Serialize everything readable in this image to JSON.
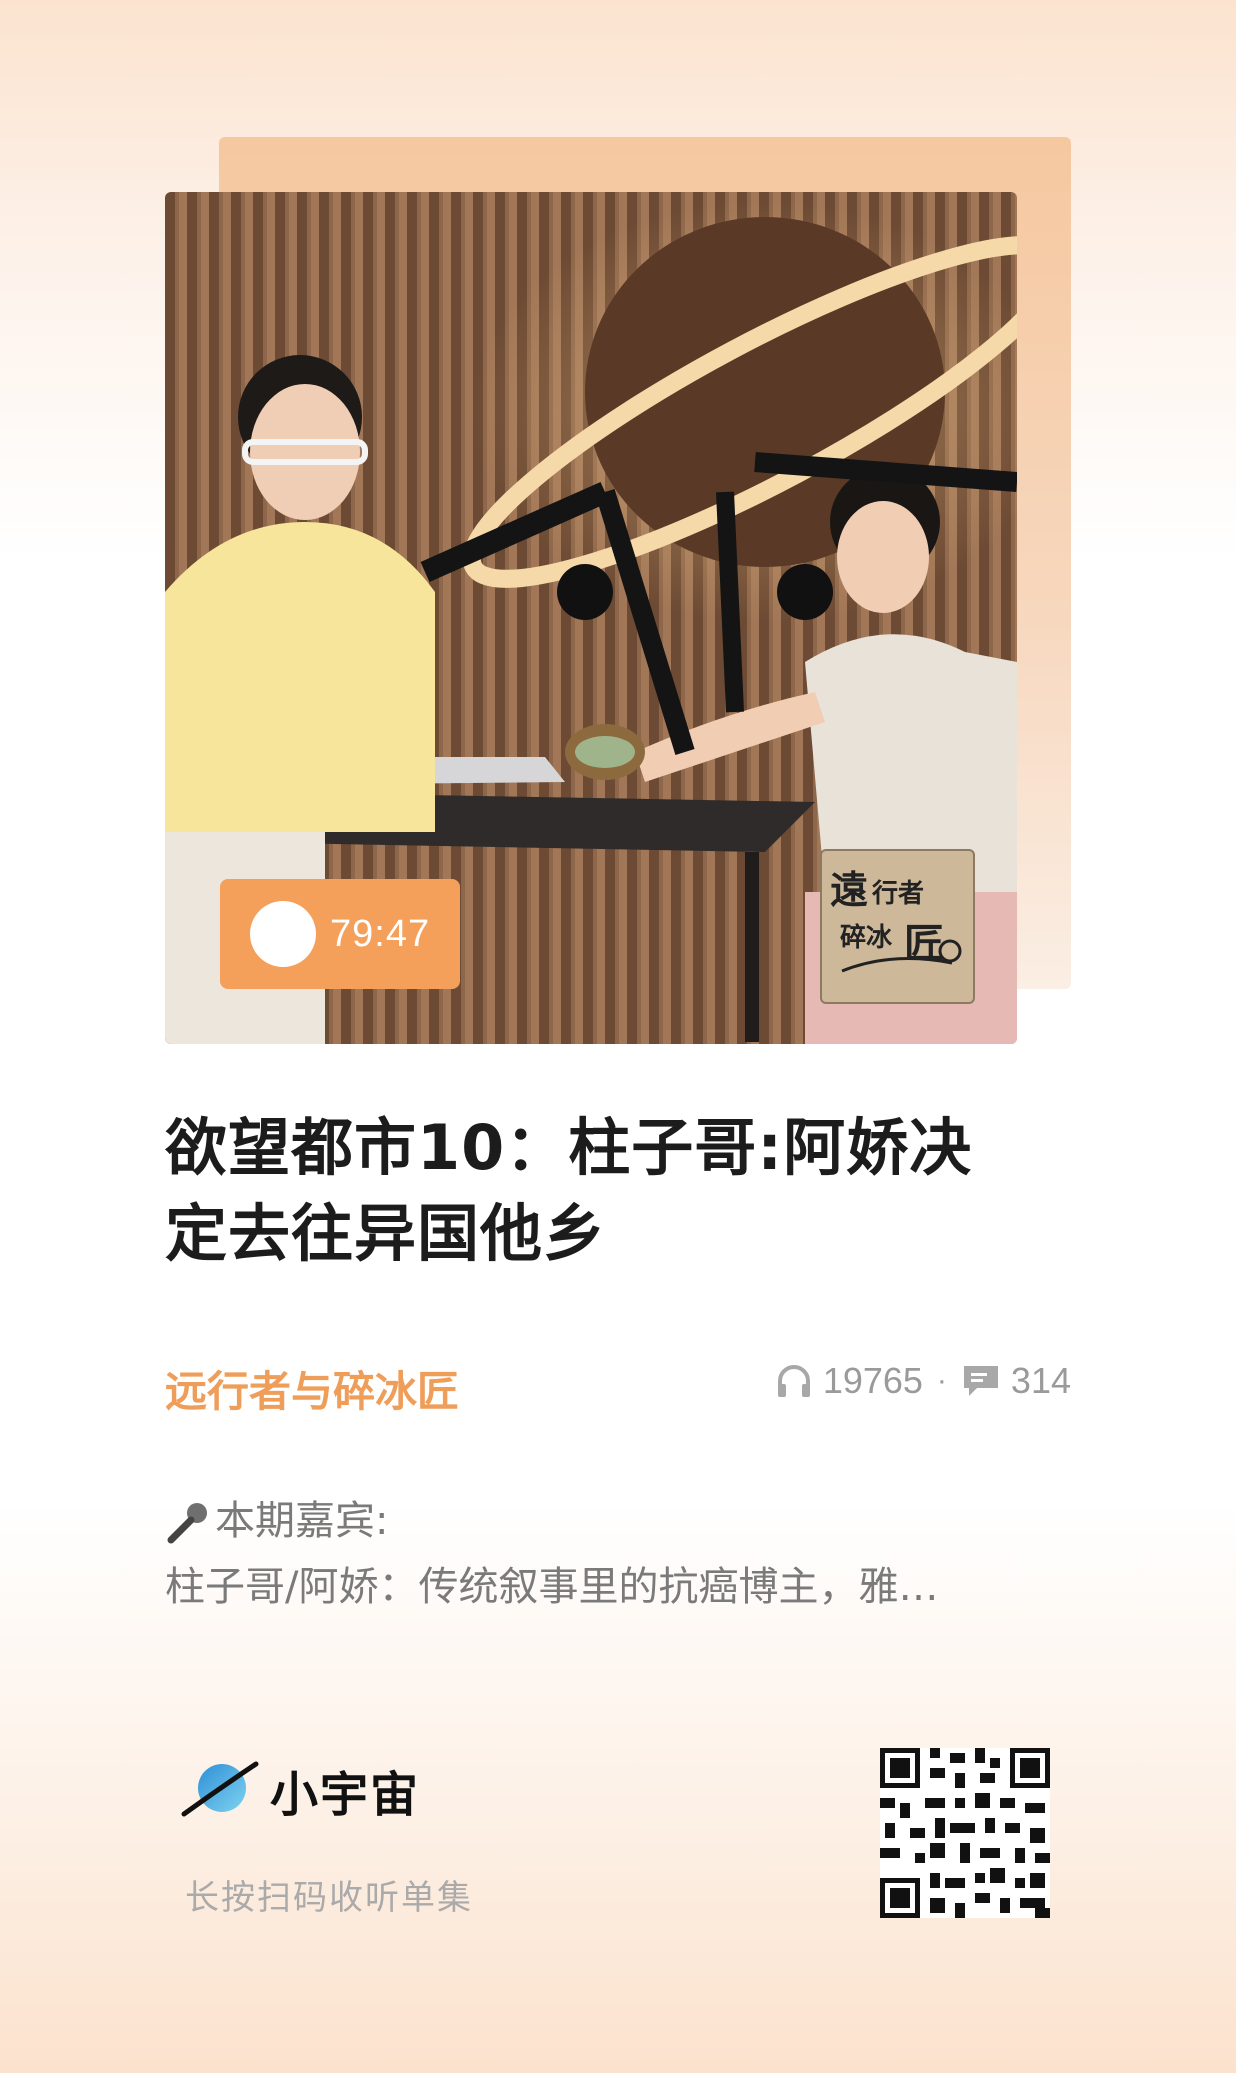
{
  "cover": {
    "duration": "79:47",
    "badge_lines": [
      "遠",
      "行者",
      "碎冰",
      "匠"
    ]
  },
  "episode": {
    "title_line1": "欲望都市10：柱子哥:阿娇决",
    "title_line2": "定去往异国他乡",
    "channel": "远行者与碎冰匠",
    "plays": "19765",
    "separator": "·",
    "comments": "314"
  },
  "description": {
    "line1": "本期嘉宾:",
    "line2": "柱子哥/阿娇：传统叙事里的抗癌博主，雅…"
  },
  "footer": {
    "brand": "小宇宙",
    "hint": "长按扫码收听单集"
  },
  "colors": {
    "accent": "#f4a05b",
    "channel": "#ef9e5a",
    "title": "#1c1c1c",
    "muted": "#9a9a9a"
  },
  "icons": [
    "play-icon",
    "headphones-icon",
    "comment-icon",
    "microphone-icon",
    "planet-logo-icon",
    "qr-code"
  ]
}
